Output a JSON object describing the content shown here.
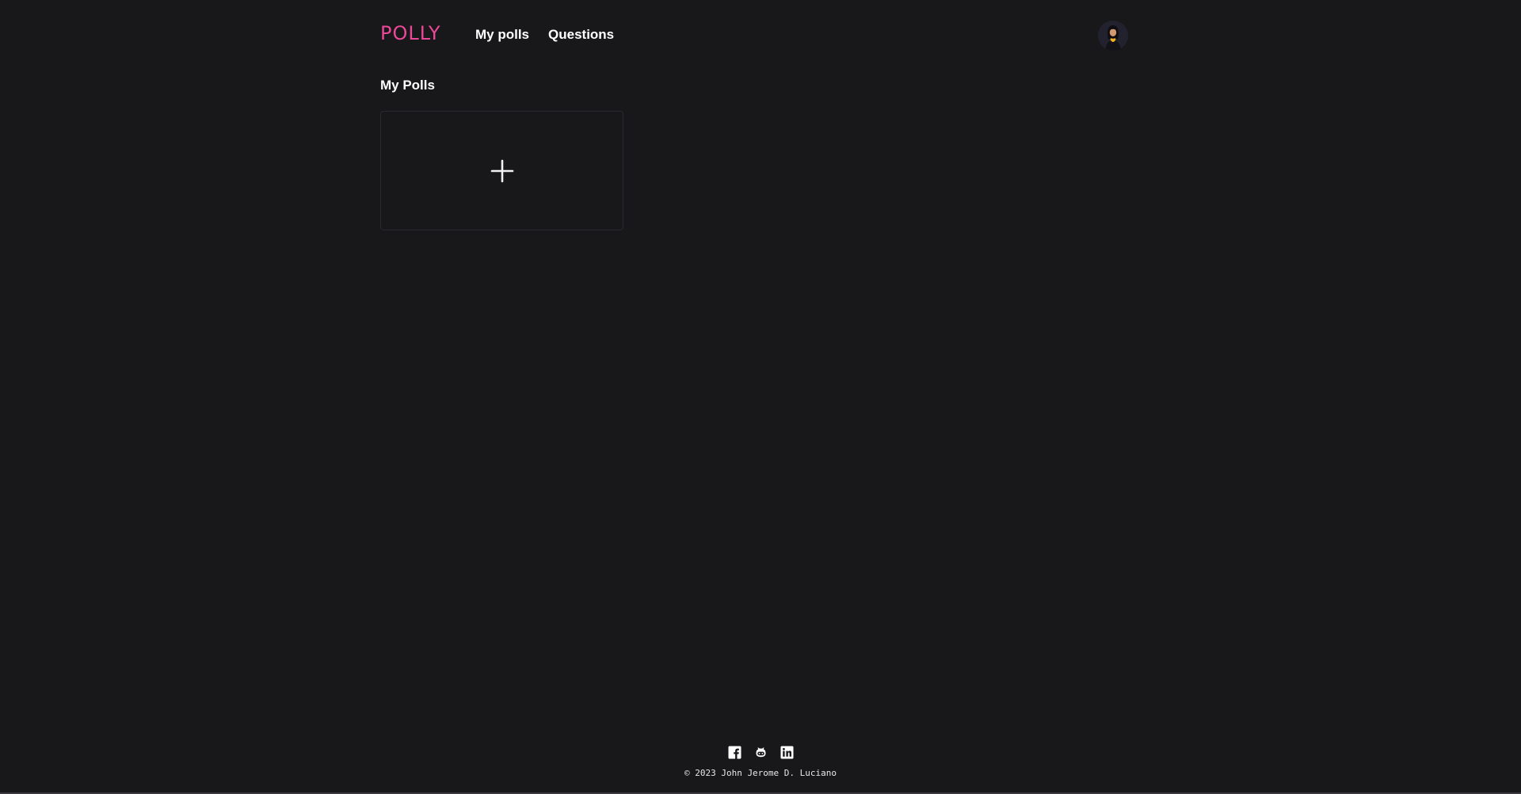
{
  "header": {
    "brand": "POLLY",
    "nav": [
      {
        "label": "My polls"
      },
      {
        "label": "Questions"
      }
    ],
    "avatar_icon": "user-avatar"
  },
  "main": {
    "title": "My Polls",
    "add_card_icon": "plus-icon"
  },
  "footer": {
    "social_icons": [
      "facebook-icon",
      "github-icon",
      "linkedin-icon"
    ],
    "copyright": "© 2023 John Jerome D. Luciano"
  },
  "colors": {
    "background": "#18181b",
    "brand": "#ec4899",
    "text": "#ffffff",
    "card_border": "#2a2a2e"
  }
}
